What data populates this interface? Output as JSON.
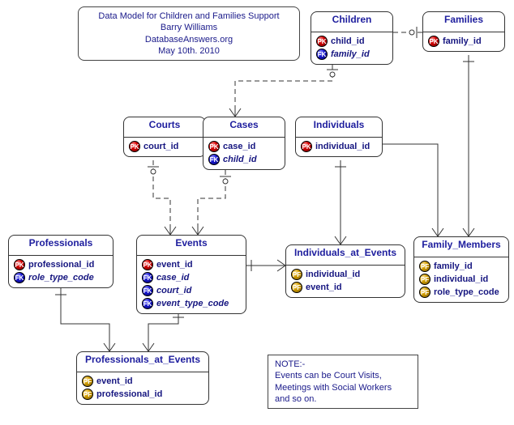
{
  "title": {
    "line1": "Data Model for Children and Families Support",
    "line2": "Barry Williams",
    "line3": "DatabaseAnswers.org",
    "line4": "May 10th.  2010"
  },
  "note": {
    "line1": "NOTE:-",
    "line2": "Events can be Court Visits,",
    "line3": "Meetings with Social Workers",
    "line4": "and so on."
  },
  "entities": {
    "children": {
      "name": "Children",
      "attrs": [
        {
          "k": "PK",
          "n": "child_id"
        },
        {
          "k": "FK",
          "n": "family_id",
          "i": true
        }
      ]
    },
    "families": {
      "name": "Families",
      "attrs": [
        {
          "k": "PK",
          "n": "family_id"
        }
      ]
    },
    "courts": {
      "name": "Courts",
      "attrs": [
        {
          "k": "PK",
          "n": "court_id"
        }
      ]
    },
    "cases": {
      "name": "Cases",
      "attrs": [
        {
          "k": "PK",
          "n": "case_id"
        },
        {
          "k": "FK",
          "n": "child_id",
          "i": true
        }
      ]
    },
    "individuals": {
      "name": "Individuals",
      "attrs": [
        {
          "k": "PK",
          "n": "individual_id"
        }
      ]
    },
    "professionals": {
      "name": "Professionals",
      "attrs": [
        {
          "k": "PK",
          "n": "professional_id"
        },
        {
          "k": "FK",
          "n": "role_type_code",
          "i": true
        }
      ]
    },
    "events": {
      "name": "Events",
      "attrs": [
        {
          "k": "PK",
          "n": "event_id"
        },
        {
          "k": "FK",
          "n": "case_id",
          "i": true
        },
        {
          "k": "FK",
          "n": "court_id",
          "i": true
        },
        {
          "k": "FK",
          "n": "event_type_code",
          "i": true
        }
      ]
    },
    "individuals_at_events": {
      "name": "Individuals_at_Events",
      "attrs": [
        {
          "k": "PF",
          "n": "individual_id"
        },
        {
          "k": "PF",
          "n": "event_id"
        }
      ]
    },
    "family_members": {
      "name": "Family_Members",
      "attrs": [
        {
          "k": "PF",
          "n": "family_id"
        },
        {
          "k": "PF",
          "n": "individual_id"
        },
        {
          "k": "PF",
          "n": "role_type_code"
        }
      ]
    },
    "professionals_at_events": {
      "name": "Professionals_at_Events",
      "attrs": [
        {
          "k": "PF",
          "n": "event_id"
        },
        {
          "k": "PF",
          "n": "professional_id"
        }
      ]
    }
  },
  "chart_data": {
    "type": "er-diagram",
    "title": "Data Model for Children and Families Support",
    "author": "Barry Williams",
    "source": "DatabaseAnswers.org",
    "date": "May 10th. 2010",
    "entities": [
      {
        "name": "Children",
        "keys": [
          {
            "name": "child_id",
            "type": "PK"
          },
          {
            "name": "family_id",
            "type": "FK"
          }
        ]
      },
      {
        "name": "Families",
        "keys": [
          {
            "name": "family_id",
            "type": "PK"
          }
        ]
      },
      {
        "name": "Courts",
        "keys": [
          {
            "name": "court_id",
            "type": "PK"
          }
        ]
      },
      {
        "name": "Cases",
        "keys": [
          {
            "name": "case_id",
            "type": "PK"
          },
          {
            "name": "child_id",
            "type": "FK"
          }
        ]
      },
      {
        "name": "Individuals",
        "keys": [
          {
            "name": "individual_id",
            "type": "PK"
          }
        ]
      },
      {
        "name": "Professionals",
        "keys": [
          {
            "name": "professional_id",
            "type": "PK"
          },
          {
            "name": "role_type_code",
            "type": "FK"
          }
        ]
      },
      {
        "name": "Events",
        "keys": [
          {
            "name": "event_id",
            "type": "PK"
          },
          {
            "name": "case_id",
            "type": "FK"
          },
          {
            "name": "court_id",
            "type": "FK"
          },
          {
            "name": "event_type_code",
            "type": "FK"
          }
        ]
      },
      {
        "name": "Individuals_at_Events",
        "keys": [
          {
            "name": "individual_id",
            "type": "PF"
          },
          {
            "name": "event_id",
            "type": "PF"
          }
        ]
      },
      {
        "name": "Family_Members",
        "keys": [
          {
            "name": "family_id",
            "type": "PF"
          },
          {
            "name": "individual_id",
            "type": "PF"
          },
          {
            "name": "role_type_code",
            "type": "PF"
          }
        ]
      },
      {
        "name": "Professionals_at_Events",
        "keys": [
          {
            "name": "event_id",
            "type": "PF"
          },
          {
            "name": "professional_id",
            "type": "PF"
          }
        ]
      }
    ],
    "relationships": [
      {
        "from": "Families",
        "to": "Children",
        "style": "dashed",
        "crowfoot_at": "Children"
      },
      {
        "from": "Children",
        "to": "Cases",
        "style": "dashed",
        "crowfoot_at": "Cases"
      },
      {
        "from": "Cases",
        "to": "Events",
        "style": "dashed",
        "crowfoot_at": "Events"
      },
      {
        "from": "Courts",
        "to": "Events",
        "style": "dashed",
        "crowfoot_at": "Events"
      },
      {
        "from": "Events",
        "to": "Individuals_at_Events",
        "style": "solid",
        "crowfoot_at": "Individuals_at_Events"
      },
      {
        "from": "Individuals",
        "to": "Individuals_at_Events",
        "style": "solid",
        "crowfoot_at": "Individuals_at_Events"
      },
      {
        "from": "Events",
        "to": "Professionals_at_Events",
        "style": "solid",
        "crowfoot_at": "Professionals_at_Events"
      },
      {
        "from": "Professionals",
        "to": "Professionals_at_Events",
        "style": "solid",
        "crowfoot_at": "Professionals_at_Events"
      },
      {
        "from": "Families",
        "to": "Family_Members",
        "style": "solid",
        "crowfoot_at": "Family_Members"
      },
      {
        "from": "Individuals",
        "to": "Family_Members",
        "style": "solid",
        "crowfoot_at": "Family_Members"
      }
    ],
    "note": "Events can be Court Visits, Meetings with Social Workers and so on."
  }
}
